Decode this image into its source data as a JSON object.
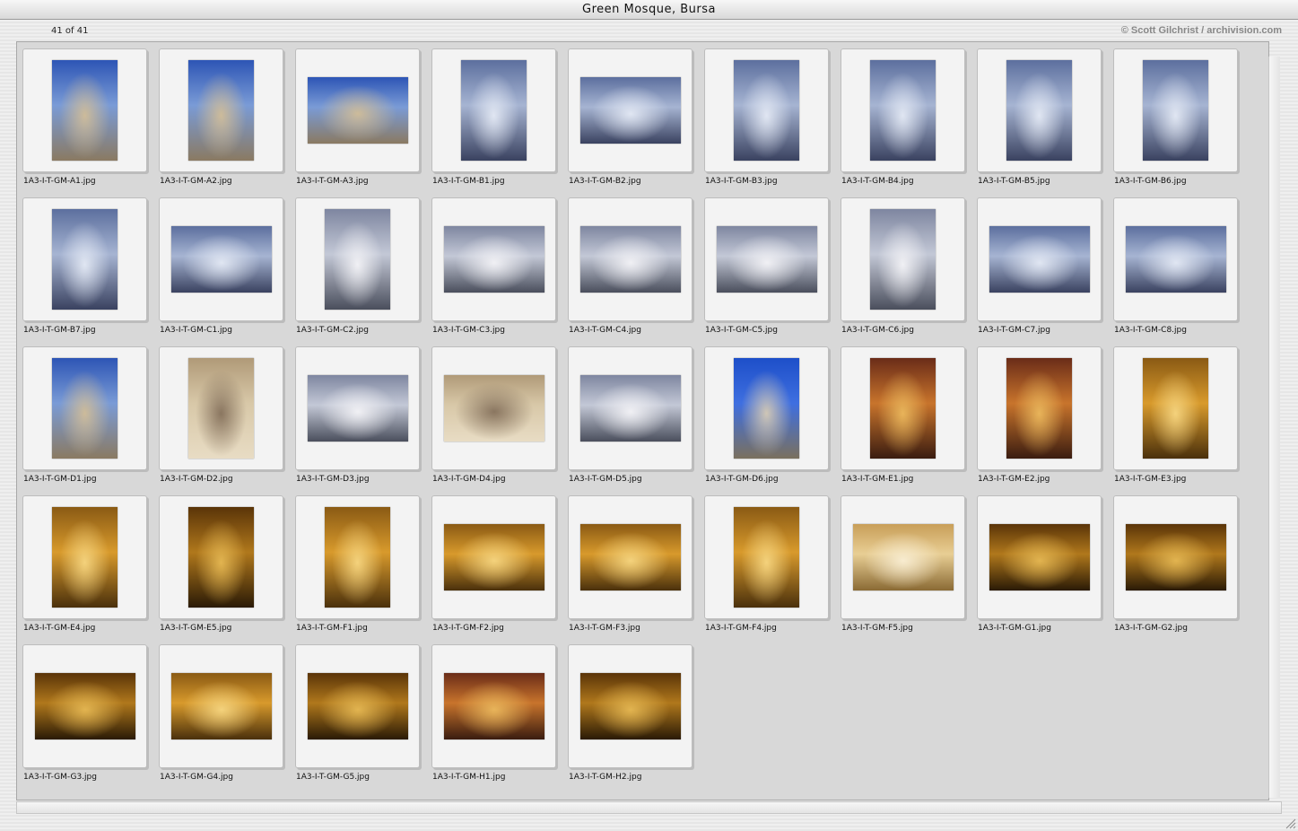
{
  "window": {
    "title": "Green Mosque, Bursa"
  },
  "toolbar": {
    "counter": "41 of 41",
    "credit": "© Scott Gilchrist / archivision.com"
  },
  "thumbnails": [
    {
      "file": "1A3-I-T-GM-A1.jpg",
      "orientation": "portrait",
      "palette": "blue-sky-stone"
    },
    {
      "file": "1A3-I-T-GM-A2.jpg",
      "orientation": "portrait",
      "palette": "blue-sky-stone"
    },
    {
      "file": "1A3-I-T-GM-A3.jpg",
      "orientation": "landscape",
      "palette": "blue-sky-stone"
    },
    {
      "file": "1A3-I-T-GM-B1.jpg",
      "orientation": "portrait",
      "palette": "blue-grey"
    },
    {
      "file": "1A3-I-T-GM-B2.jpg",
      "orientation": "landscape",
      "palette": "blue-grey"
    },
    {
      "file": "1A3-I-T-GM-B3.jpg",
      "orientation": "portrait",
      "palette": "blue-grey"
    },
    {
      "file": "1A3-I-T-GM-B4.jpg",
      "orientation": "portrait",
      "palette": "blue-grey"
    },
    {
      "file": "1A3-I-T-GM-B5.jpg",
      "orientation": "portrait",
      "palette": "blue-grey"
    },
    {
      "file": "1A3-I-T-GM-B6.jpg",
      "orientation": "portrait",
      "palette": "blue-grey"
    },
    {
      "file": "1A3-I-T-GM-B7.jpg",
      "orientation": "portrait",
      "palette": "blue-grey"
    },
    {
      "file": "1A3-I-T-GM-C1.jpg",
      "orientation": "landscape",
      "palette": "blue-grey"
    },
    {
      "file": "1A3-I-T-GM-C2.jpg",
      "orientation": "portrait",
      "palette": "grey-stone"
    },
    {
      "file": "1A3-I-T-GM-C3.jpg",
      "orientation": "landscape",
      "palette": "grey-stone"
    },
    {
      "file": "1A3-I-T-GM-C4.jpg",
      "orientation": "landscape",
      "palette": "grey-stone"
    },
    {
      "file": "1A3-I-T-GM-C5.jpg",
      "orientation": "landscape",
      "palette": "grey-stone"
    },
    {
      "file": "1A3-I-T-GM-C6.jpg",
      "orientation": "portrait",
      "palette": "grey-stone"
    },
    {
      "file": "1A3-I-T-GM-C7.jpg",
      "orientation": "landscape",
      "palette": "blue-grey"
    },
    {
      "file": "1A3-I-T-GM-C8.jpg",
      "orientation": "landscape",
      "palette": "blue-grey"
    },
    {
      "file": "1A3-I-T-GM-D1.jpg",
      "orientation": "portrait",
      "palette": "blue-sky-stone"
    },
    {
      "file": "1A3-I-T-GM-D2.jpg",
      "orientation": "portrait",
      "palette": "sand-stone"
    },
    {
      "file": "1A3-I-T-GM-D3.jpg",
      "orientation": "landscape",
      "palette": "grey-stone"
    },
    {
      "file": "1A3-I-T-GM-D4.jpg",
      "orientation": "landscape",
      "palette": "sand-stone"
    },
    {
      "file": "1A3-I-T-GM-D5.jpg",
      "orientation": "landscape",
      "palette": "grey-stone"
    },
    {
      "file": "1A3-I-T-GM-D6.jpg",
      "orientation": "portrait",
      "palette": "minaret-sky"
    },
    {
      "file": "1A3-I-T-GM-E1.jpg",
      "orientation": "portrait",
      "palette": "warm-interior"
    },
    {
      "file": "1A3-I-T-GM-E2.jpg",
      "orientation": "portrait",
      "palette": "warm-interior"
    },
    {
      "file": "1A3-I-T-GM-E3.jpg",
      "orientation": "portrait",
      "palette": "gold-interior"
    },
    {
      "file": "1A3-I-T-GM-E4.jpg",
      "orientation": "portrait",
      "palette": "gold-interior"
    },
    {
      "file": "1A3-I-T-GM-E5.jpg",
      "orientation": "portrait",
      "palette": "dark-gold"
    },
    {
      "file": "1A3-I-T-GM-F1.jpg",
      "orientation": "portrait",
      "palette": "gold-interior"
    },
    {
      "file": "1A3-I-T-GM-F2.jpg",
      "orientation": "landscape",
      "palette": "gold-interior"
    },
    {
      "file": "1A3-I-T-GM-F3.jpg",
      "orientation": "landscape",
      "palette": "gold-interior"
    },
    {
      "file": "1A3-I-T-GM-F4.jpg",
      "orientation": "portrait",
      "palette": "gold-interior"
    },
    {
      "file": "1A3-I-T-GM-F5.jpg",
      "orientation": "landscape",
      "palette": "pale-gold"
    },
    {
      "file": "1A3-I-T-GM-G1.jpg",
      "orientation": "landscape",
      "palette": "dark-gold"
    },
    {
      "file": "1A3-I-T-GM-G2.jpg",
      "orientation": "landscape",
      "palette": "dark-gold"
    },
    {
      "file": "1A3-I-T-GM-G3.jpg",
      "orientation": "landscape",
      "palette": "dark-gold"
    },
    {
      "file": "1A3-I-T-GM-G4.jpg",
      "orientation": "landscape",
      "palette": "gold-interior"
    },
    {
      "file": "1A3-I-T-GM-G5.jpg",
      "orientation": "landscape",
      "palette": "dark-gold"
    },
    {
      "file": "1A3-I-T-GM-H1.jpg",
      "orientation": "landscape",
      "palette": "warm-interior"
    },
    {
      "file": "1A3-I-T-GM-H2.jpg",
      "orientation": "landscape",
      "palette": "dark-gold"
    }
  ],
  "palettes": {
    "blue-sky-stone": [
      "#2d55b5",
      "#7a9bd6",
      "#cdbb9a",
      "#8a7a62"
    ],
    "blue-grey": [
      "#5c6f9e",
      "#a6b4d2",
      "#e0e6f2",
      "#3a4260"
    ],
    "grey-stone": [
      "#7e86a0",
      "#c3c8d6",
      "#f0f0f4",
      "#4a4e5c"
    ],
    "sand-stone": [
      "#b09a78",
      "#d8c8a8",
      "#8a7660",
      "#e8dcc4"
    ],
    "minaret-sky": [
      "#1d4fc9",
      "#3f6fe0",
      "#cfc6b6",
      "#7a705e"
    ],
    "warm-interior": [
      "#6a2c18",
      "#c8742c",
      "#e8b45a",
      "#3a1c10"
    ],
    "gold-interior": [
      "#8a5a14",
      "#d89a2c",
      "#f4d27c",
      "#4a300c"
    ],
    "dark-gold": [
      "#5a3408",
      "#b0781c",
      "#e2b450",
      "#2a1a06"
    ],
    "pale-gold": [
      "#c89e58",
      "#e8ce94",
      "#f8ecd0",
      "#8a6a34"
    ]
  }
}
